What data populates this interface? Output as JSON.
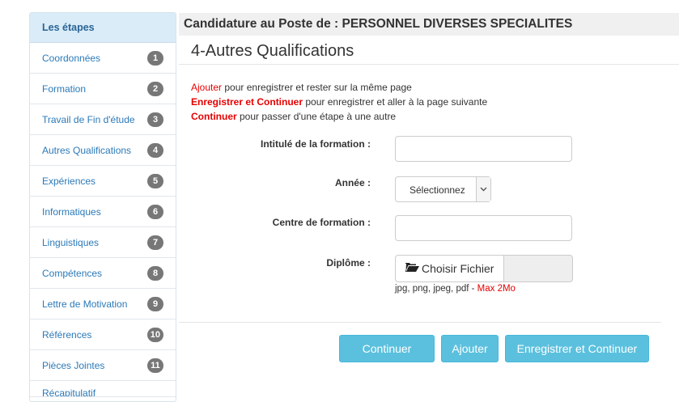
{
  "sidebar": {
    "title": "Les étapes",
    "items": [
      {
        "label": "Coordonnées",
        "badge": "1"
      },
      {
        "label": "Formation",
        "badge": "2"
      },
      {
        "label": "Travail de Fin d'étude",
        "badge": "3"
      },
      {
        "label": "Autres Qualifications",
        "badge": "4"
      },
      {
        "label": "Expériences",
        "badge": "5"
      },
      {
        "label": "Informatiques",
        "badge": "6"
      },
      {
        "label": "Linguistiques",
        "badge": "7"
      },
      {
        "label": "Compétences",
        "badge": "8"
      },
      {
        "label": "Lettre de Motivation",
        "badge": "9"
      },
      {
        "label": "Références",
        "badge": "10"
      },
      {
        "label": "Pièces Jointes",
        "badge": "11"
      },
      {
        "label": "Récapitulatif",
        "badge": ""
      }
    ]
  },
  "header": {
    "title": "Candidature au Poste de : PERSONNEL DIVERSES SPECIALITES"
  },
  "section": {
    "title": "4-Autres Qualifications"
  },
  "instructions": [
    {
      "keyword": "Ajouter",
      "text": " pour enregistrer et rester sur la même page"
    },
    {
      "keyword": "Enregistrer et Continuer",
      "text": " pour enregistrer et aller à la page suivante"
    },
    {
      "keyword": "Continuer",
      "text": " pour passer d'une étape à une autre"
    }
  ],
  "form": {
    "intitule_label": "Intitulé de la formation :",
    "intitule_value": "",
    "annee_label": "Année :",
    "annee_selected": "Sélectionnez",
    "centre_label": "Centre de formation :",
    "centre_value": "",
    "diplome_label": "Diplôme :",
    "file_button": "Choisir Fichier",
    "file_formats": "jpg, png, jpeg, pdf - ",
    "file_max": "Max 2Mo"
  },
  "buttons": {
    "continuer": "Continuer",
    "ajouter": "Ajouter",
    "enregistrer_continuer": "Enregistrer et Continuer"
  },
  "colors": {
    "accent": "#5bc0de",
    "link": "#2b79b8",
    "keyword_red": "#e60000",
    "badge": "#777777"
  },
  "icons": {
    "file_button_icon": "folder-open-icon",
    "select_icon": "chevron-down-icon"
  }
}
